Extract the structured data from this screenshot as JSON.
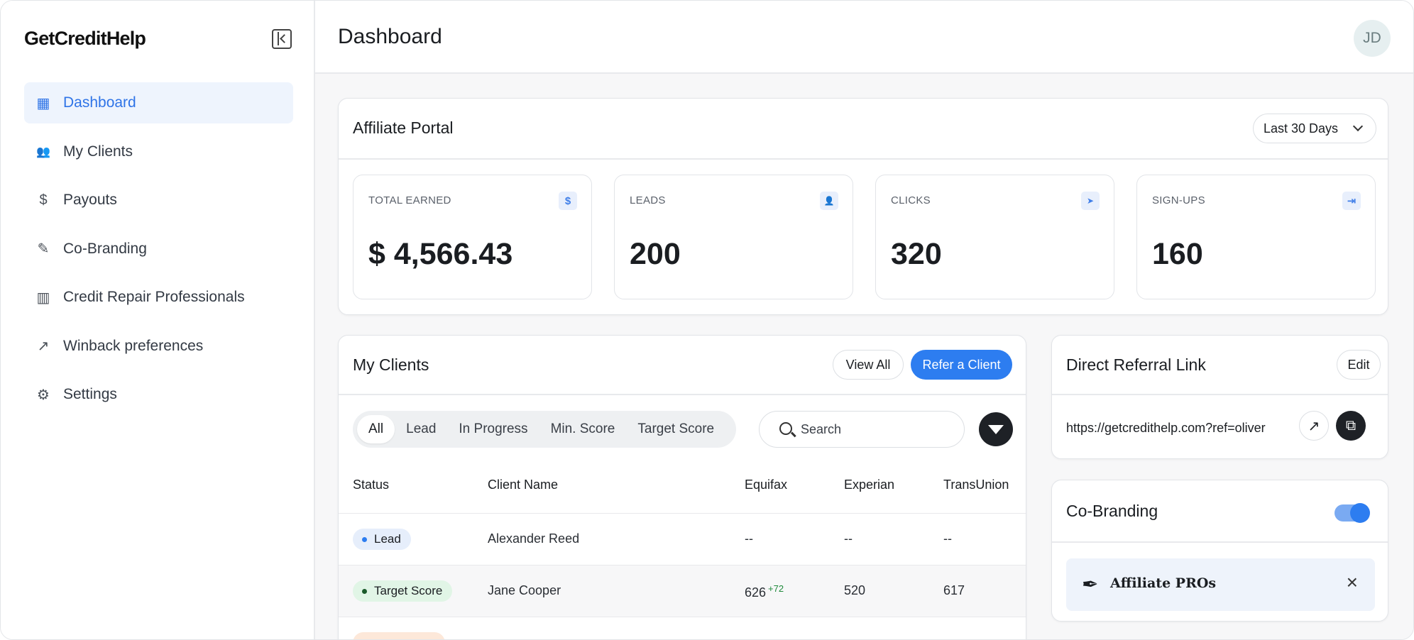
{
  "app": {
    "logo": "GetCreditHelp"
  },
  "sidebar": {
    "items": [
      {
        "label": "Dashboard",
        "icon": "dashboard-icon",
        "glyph": "▦",
        "active": true
      },
      {
        "label": "My Clients",
        "icon": "users-icon",
        "glyph": "👥",
        "active": false
      },
      {
        "label": "Payouts",
        "icon": "dollar-icon",
        "glyph": "$",
        "active": false
      },
      {
        "label": "Co-Branding",
        "icon": "edit-icon",
        "glyph": "✎",
        "active": false
      },
      {
        "label": "Credit Repair Professionals",
        "icon": "building-icon",
        "glyph": "▥",
        "active": false
      },
      {
        "label": "Winback preferences",
        "icon": "trending-up-icon",
        "glyph": "↗",
        "active": false
      },
      {
        "label": "Settings",
        "icon": "gear-icon",
        "glyph": "⚙",
        "active": false
      }
    ]
  },
  "header": {
    "title": "Dashboard",
    "avatar_initials": "JD"
  },
  "portal": {
    "title": "Affiliate Portal",
    "range": "Last 30 Days",
    "stats": [
      {
        "label": "TOTAL EARNED",
        "value": "$ 4,566.43",
        "icon": "dollar-icon",
        "glyph": "$"
      },
      {
        "label": "LEADS",
        "value": "200",
        "icon": "user-icon",
        "glyph": "👤"
      },
      {
        "label": "CLICKS",
        "value": "320",
        "icon": "cursor-icon",
        "glyph": "➤"
      },
      {
        "label": "SIGN-UPS",
        "value": "160",
        "icon": "sign-in-icon",
        "glyph": "⇥"
      }
    ]
  },
  "clients": {
    "title": "My Clients",
    "view_all": "View All",
    "refer": "Refer a Client",
    "tabs": [
      "All",
      "Lead",
      "In Progress",
      "Min. Score",
      "Target Score"
    ],
    "search_placeholder": "Search",
    "columns": [
      "Status",
      "Client Name",
      "Equifax",
      "Experian",
      "TransUnion"
    ],
    "rows": [
      {
        "status": "Lead",
        "status_type": "lead",
        "name": "Alexander Reed",
        "equifax": "--",
        "equifax_delta": "",
        "experian": "--",
        "transunion": "--"
      },
      {
        "status": "Target Score",
        "status_type": "target",
        "name": "Jane Cooper",
        "equifax": "626",
        "equifax_delta": "+72",
        "experian": "520",
        "transunion": "617"
      },
      {
        "status": "",
        "status_type": "progress",
        "name": "",
        "equifax": "",
        "equifax_delta": "",
        "experian": "",
        "transunion": ""
      }
    ]
  },
  "referral": {
    "title": "Direct Referral Link",
    "edit": "Edit",
    "url": "https://getcredithelp.com?ref=oliver"
  },
  "cobranding": {
    "title": "Co-Branding",
    "enabled": true,
    "brand_name": "Affiliate PROs"
  },
  "colors": {
    "accent": "#2d7df0",
    "active_bg": "#eef4fd",
    "dark": "#1e2126"
  }
}
